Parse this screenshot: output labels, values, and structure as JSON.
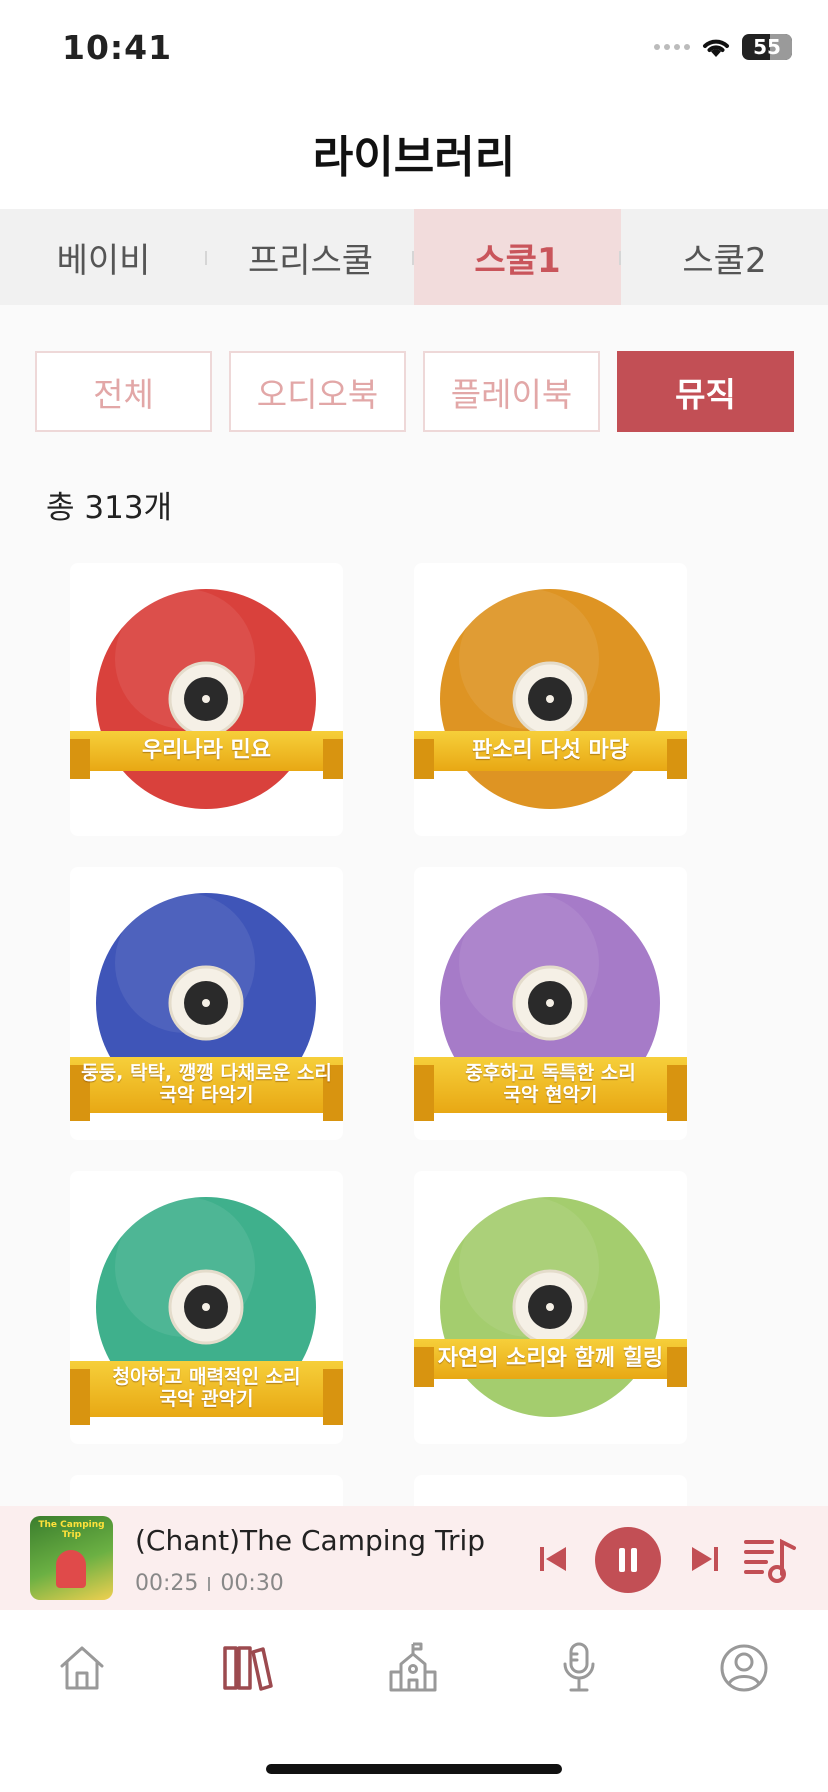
{
  "status_bar": {
    "time": "10:41",
    "battery": "55"
  },
  "header": {
    "title": "라이브러리"
  },
  "grade_tabs": [
    {
      "label": "베이비",
      "active": false
    },
    {
      "label": "프리스쿨",
      "active": false
    },
    {
      "label": "스쿨1",
      "active": true
    },
    {
      "label": "스쿨2",
      "active": false
    }
  ],
  "categories": [
    {
      "label": "전체",
      "active": false
    },
    {
      "label": "오디오북",
      "active": false
    },
    {
      "label": "플레이북",
      "active": false
    },
    {
      "label": "뮤직",
      "active": true
    }
  ],
  "total_count": "총 313개",
  "albums": [
    {
      "line1": "우리나라 민요",
      "line2": ""
    },
    {
      "line1": "판소리 다섯 마당",
      "line2": ""
    },
    {
      "line1": "둥둥, 탁탁, 깽깽 다채로운 소리",
      "line2": "국악 타악기"
    },
    {
      "line1": "중후하고 독특한 소리",
      "line2": "국악 현악기"
    },
    {
      "line1": "청아하고 매력적인 소리",
      "line2": "국악 관악기"
    },
    {
      "line1": "자연의 소리와 함께 힐링",
      "line2": ""
    }
  ],
  "album_colors": [
    "#d9413c",
    "#de9423",
    "#3f55b8",
    "#a67bc8",
    "#3fb08c",
    "#a4cd6e"
  ],
  "now_playing": {
    "art_title": "The Camping Trip",
    "track": "(Chant)The Camping Trip",
    "elapsed": "00:25",
    "duration": "00:30"
  },
  "colors": {
    "accent": "#c24f55",
    "accent_light": "#f2dcdc",
    "banner": "#f2c230"
  },
  "tabbar_icons": [
    "home-icon",
    "library-icon",
    "school-icon",
    "microphone-icon",
    "profile-icon"
  ]
}
